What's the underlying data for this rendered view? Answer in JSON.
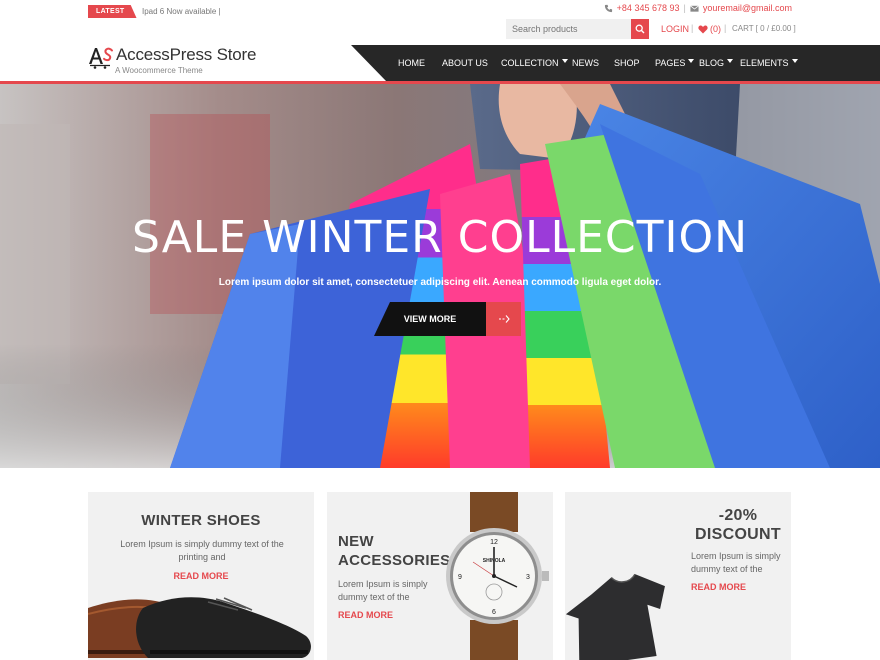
{
  "topbar": {
    "latest_label": "LATEST",
    "ticker_text": "Ipad 6 Now available |",
    "phone": "+84 345 678 93",
    "separator": "|",
    "email": "youremail@gmail.com"
  },
  "brand": {
    "logo_mark": "AS",
    "name": "AccessPress Store",
    "tagline": "A Woocommerce Theme"
  },
  "header": {
    "search_placeholder": "Search products",
    "login_label": "LOGIN",
    "wishlist_count": "(0)",
    "separator": "|",
    "cart_label": "CART [ 0 / £0.00 ]"
  },
  "nav": {
    "items": [
      {
        "label": "HOME",
        "dropdown": false
      },
      {
        "label": "ABOUT US",
        "dropdown": false
      },
      {
        "label": "COLLECTION",
        "dropdown": true
      },
      {
        "label": "NEWS",
        "dropdown": false
      },
      {
        "label": "SHOP",
        "dropdown": false
      },
      {
        "label": "PAGES",
        "dropdown": true
      },
      {
        "label": "BLOG",
        "dropdown": true
      },
      {
        "label": "ELEMENTS",
        "dropdown": true
      }
    ]
  },
  "hero": {
    "title": "SALE WINTER COLLECTION",
    "text": "Lorem ipsum dolor sit amet, consectetuer adipiscing elit. Aenean commodo ligula eget dolor.",
    "button_label": "VIEW MORE"
  },
  "promos": [
    {
      "title": "WINTER SHOES",
      "text": "Lorem Ipsum is simply dummy text of the printing and",
      "link": "READ MORE"
    },
    {
      "title_line1": "NEW",
      "title_line2": "ACCESSORIES",
      "text": "Lorem Ipsum is simply dummy text of the",
      "link": "READ MORE",
      "watch_brand": "SHINOLA"
    },
    {
      "title_line1": "-20%",
      "title_line2": "DISCOUNT",
      "text": "Lorem Ipsum is simply dummy text of the",
      "link": "READ MORE"
    }
  ],
  "colors": {
    "accent": "#e5484d",
    "nav_bg": "#272727",
    "card_bg": "#f1f1f1"
  },
  "icons": [
    "phone-icon",
    "mail-icon",
    "search-icon",
    "heart-icon",
    "chevron-down-icon",
    "arrow-right-icon"
  ]
}
